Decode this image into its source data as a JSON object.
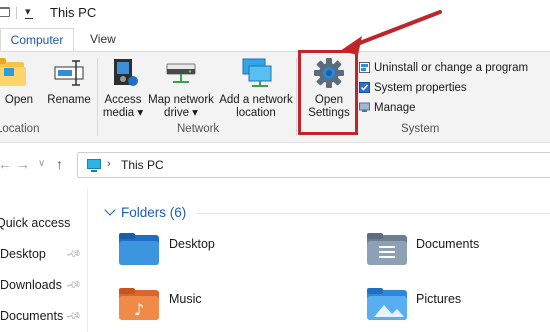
{
  "window": {
    "title": "This PC"
  },
  "ribbon": {
    "tabs": [
      {
        "label": "Computer"
      },
      {
        "label": "View"
      }
    ],
    "buttons": {
      "open": "Open",
      "rename": "Rename",
      "access_media_1": "Access",
      "access_media_2": "media ▾",
      "map_drive_1": "Map network",
      "map_drive_2": "drive ▾",
      "add_location_1": "Add a network",
      "add_location_2": "location",
      "open_settings_1": "Open",
      "open_settings_2": "Settings"
    },
    "system_items": [
      {
        "label": "Uninstall or change a program"
      },
      {
        "label": "System properties"
      },
      {
        "label": "Manage"
      }
    ],
    "groups": {
      "location": "Location",
      "network": "Network",
      "system": "System"
    }
  },
  "address": {
    "path": "This PC"
  },
  "nav_pane": {
    "items": [
      {
        "label": "Quick access"
      },
      {
        "label": "Desktop"
      },
      {
        "label": "Downloads"
      },
      {
        "label": "Documents"
      }
    ]
  },
  "content": {
    "folders_header": "Folders (6)",
    "folders": [
      {
        "label": "Desktop"
      },
      {
        "label": "Documents"
      },
      {
        "label": "Music"
      },
      {
        "label": "Pictures"
      }
    ]
  },
  "colors": {
    "accent": "#1a5fb4",
    "annotation": "#c0252a"
  }
}
